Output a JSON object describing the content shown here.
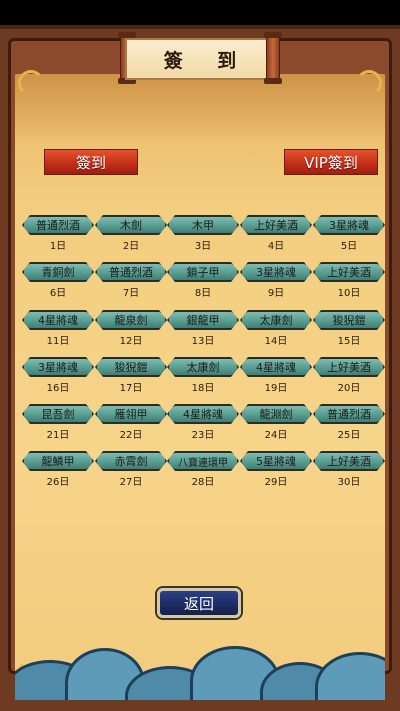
{
  "title": "簽 到",
  "buttons": {
    "sign": "簽到",
    "vip_sign": "VIP簽到",
    "back": "返回"
  },
  "days": [
    {
      "reward": "普通烈酒",
      "label": "1日"
    },
    {
      "reward": "木劍",
      "label": "2日"
    },
    {
      "reward": "木甲",
      "label": "3日"
    },
    {
      "reward": "上好美酒",
      "label": "4日"
    },
    {
      "reward": "3星將魂",
      "label": "5日"
    },
    {
      "reward": "青銅劍",
      "label": "6日"
    },
    {
      "reward": "普通烈酒",
      "label": "7日"
    },
    {
      "reward": "鎖子甲",
      "label": "8日"
    },
    {
      "reward": "3星將魂",
      "label": "9日"
    },
    {
      "reward": "上好美酒",
      "label": "10日"
    },
    {
      "reward": "4星將魂",
      "label": "11日"
    },
    {
      "reward": "龍泉劍",
      "label": "12日"
    },
    {
      "reward": "銀龍甲",
      "label": "13日"
    },
    {
      "reward": "太康劍",
      "label": "14日"
    },
    {
      "reward": "狻猊鎧",
      "label": "15日"
    },
    {
      "reward": "3星將魂",
      "label": "16日"
    },
    {
      "reward": "狻猊鎧",
      "label": "17日"
    },
    {
      "reward": "太康劍",
      "label": "18日"
    },
    {
      "reward": "4星將魂",
      "label": "19日"
    },
    {
      "reward": "上好美酒",
      "label": "20日"
    },
    {
      "reward": "昆吾劍",
      "label": "21日"
    },
    {
      "reward": "雁翎甲",
      "label": "22日"
    },
    {
      "reward": "4星將魂",
      "label": "23日"
    },
    {
      "reward": "龍淵劍",
      "label": "24日"
    },
    {
      "reward": "普通烈酒",
      "label": "25日"
    },
    {
      "reward": "龍鱗甲",
      "label": "26日"
    },
    {
      "reward": "赤霄劍",
      "label": "27日"
    },
    {
      "reward": "八寶連環甲",
      "label": "28日"
    },
    {
      "reward": "5星將魂",
      "label": "29日"
    },
    {
      "reward": "上好美酒",
      "label": "30日"
    }
  ],
  "colors": {
    "parchment": "#f6d48a",
    "frame": "#6e3a22",
    "plaque": "#5c9f95",
    "sign_button": "#c4301a",
    "back_button": "#1d2b63"
  }
}
